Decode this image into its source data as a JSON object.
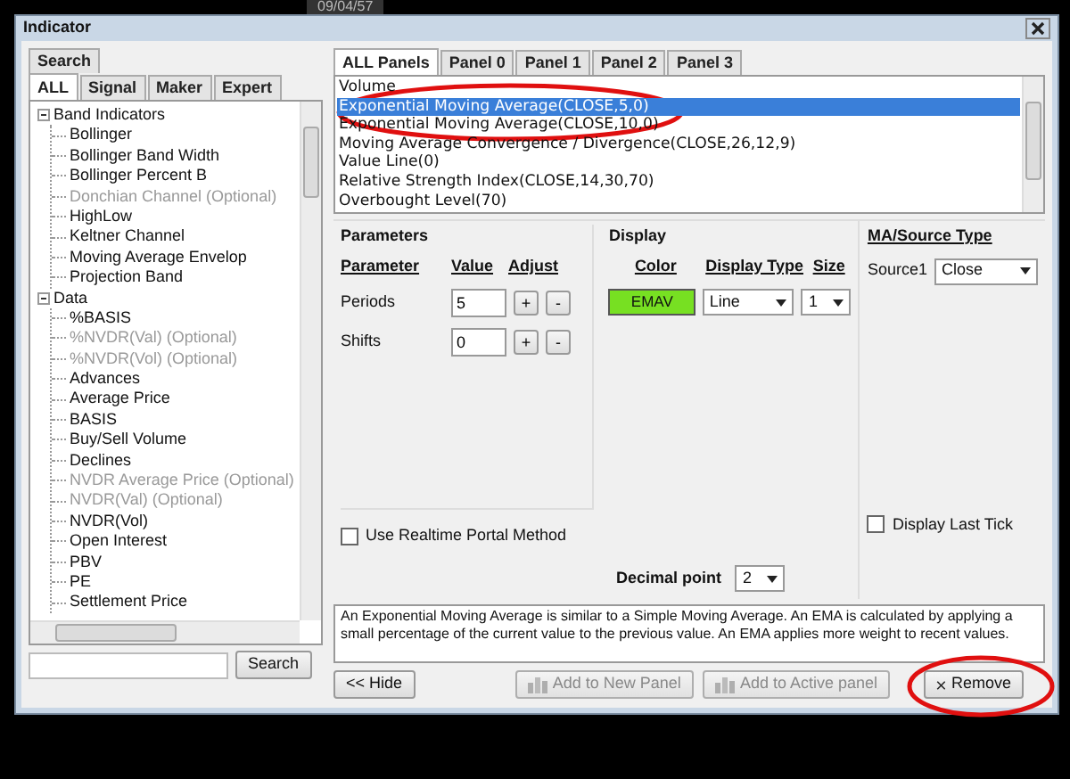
{
  "background": {
    "date_label": "09/04/57"
  },
  "window": {
    "title": "Indicator"
  },
  "left_tab_rows": [
    [
      {
        "label": "Search",
        "selected": false
      }
    ],
    [
      {
        "label": "ALL",
        "selected": true
      },
      {
        "label": "Signal",
        "selected": false
      },
      {
        "label": "Maker",
        "selected": false
      },
      {
        "label": "Expert",
        "selected": false
      }
    ]
  ],
  "tree": [
    {
      "label": "Band Indicators",
      "expanded": true,
      "children": [
        {
          "label": "Bollinger",
          "disabled": false
        },
        {
          "label": "Bollinger Band Width",
          "disabled": false
        },
        {
          "label": "Bollinger Percent B",
          "disabled": false
        },
        {
          "label": "Donchian Channel (Optional)",
          "disabled": true
        },
        {
          "label": "HighLow",
          "disabled": false
        },
        {
          "label": "Keltner Channel",
          "disabled": false
        },
        {
          "label": "Moving Average Envelop",
          "disabled": false
        },
        {
          "label": "Projection Band",
          "disabled": false
        }
      ]
    },
    {
      "label": "Data",
      "expanded": true,
      "children": [
        {
          "label": "%BASIS",
          "disabled": false
        },
        {
          "label": "%NVDR(Val) (Optional)",
          "disabled": true
        },
        {
          "label": "%NVDR(Vol) (Optional)",
          "disabled": true
        },
        {
          "label": "Advances",
          "disabled": false
        },
        {
          "label": "Average Price",
          "disabled": false
        },
        {
          "label": "BASIS",
          "disabled": false
        },
        {
          "label": "Buy/Sell Volume",
          "disabled": false
        },
        {
          "label": "Declines",
          "disabled": false
        },
        {
          "label": "NVDR Average Price (Optional)",
          "disabled": true
        },
        {
          "label": "NVDR(Val) (Optional)",
          "disabled": true
        },
        {
          "label": "NVDR(Vol)",
          "disabled": false
        },
        {
          "label": "Open Interest",
          "disabled": false
        },
        {
          "label": "PBV",
          "disabled": false
        },
        {
          "label": "PE",
          "disabled": false
        },
        {
          "label": "Settlement Price",
          "disabled": false
        }
      ]
    }
  ],
  "search": {
    "button": "Search"
  },
  "panel_tabs": [
    {
      "label": "ALL Panels",
      "selected": true
    },
    {
      "label": "Panel 0",
      "selected": false
    },
    {
      "label": "Panel 1",
      "selected": false
    },
    {
      "label": "Panel 2",
      "selected": false
    },
    {
      "label": "Panel 3",
      "selected": false
    }
  ],
  "indicator_list": [
    {
      "label": "Volume",
      "selected": false
    },
    {
      "label": "Exponential Moving Average(CLOSE,5,0)",
      "selected": true
    },
    {
      "label": "Exponential Moving Average(CLOSE,10,0)",
      "selected": false
    },
    {
      "label": "Moving Average Convergence / Divergence(CLOSE,26,12,9)",
      "selected": false
    },
    {
      "label": "Value Line(0)",
      "selected": false
    },
    {
      "label": "Relative Strength Index(CLOSE,14,30,70)",
      "selected": false
    },
    {
      "label": "Overbought Level(70)",
      "selected": false
    }
  ],
  "parameters": {
    "title": "Parameters",
    "headers": [
      "Parameter",
      "Value",
      "Adjust"
    ],
    "rows": [
      {
        "name": "Periods",
        "value": "5",
        "plus": "+",
        "minus": "-"
      },
      {
        "name": "Shifts",
        "value": "0",
        "plus": "+",
        "minus": "-"
      }
    ],
    "realtime": {
      "label": "Use Realtime Portal Method",
      "checked": false
    }
  },
  "display": {
    "title": "Display",
    "headers": [
      "Color",
      "Display Type",
      "Size"
    ],
    "color": "#77e022",
    "color_label": "EMAV",
    "display_type": "Line",
    "size": "1"
  },
  "ma_source": {
    "title": "MA/Source Type",
    "source_label": "Source1",
    "source": "Close",
    "last_tick": {
      "label": "Display Last Tick",
      "checked": false
    }
  },
  "decimal": {
    "label": "Decimal point",
    "value": "2"
  },
  "description": "An Exponential Moving Average is similar to a Simple Moving Average. An EMA is calculated by applying a small percentage of the current value to the previous value. An EMA applies more weight to recent values.",
  "buttons": [
    {
      "label": "<< Hide",
      "kind": "hide",
      "disabled": false
    },
    {
      "label": "Add to New Panel",
      "kind": "new-panel",
      "disabled": true
    },
    {
      "label": "Add to Active panel",
      "kind": "active-panel",
      "disabled": true
    },
    {
      "label": "Remove",
      "kind": "remove",
      "disabled": false
    }
  ]
}
